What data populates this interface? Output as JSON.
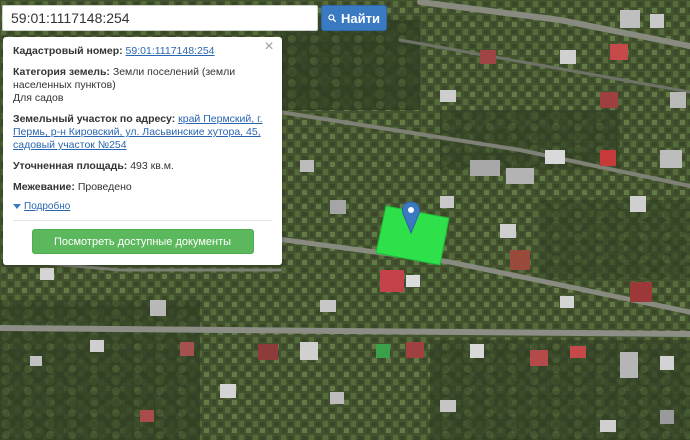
{
  "search": {
    "value": "59:01:1117148:254",
    "button_label": "Найти"
  },
  "info": {
    "cadastral_label": "Кадастровый номер:",
    "cadastral_value": "59:01:1117148:254",
    "category_label": "Категория земель:",
    "category_value_line1": "Земли поселений (земли",
    "category_value_line2": "населенных пунктов)",
    "category_value_line3": "Для садов",
    "address_label": "Земельный участок по адресу:",
    "address_line1": "край Пермский, г.",
    "address_line2": "Пермь, р-н Кировский, ул. Ласьвинские хутора, 45,",
    "address_line3": "садовый участок №254",
    "area_label": "Уточненная площадь:",
    "area_value": "493 кв.м.",
    "survey_label": "Межевание:",
    "survey_value": "Проведено",
    "details_label": "Подробно",
    "docs_button_label": "Посмотреть доступные документы",
    "close_symbol": "×"
  },
  "colors": {
    "parcel_fill": "#2ee04a",
    "pin": "#3a7ac2",
    "search_button": "#3a7ac2",
    "docs_button": "#5cb85c"
  },
  "icons": {
    "search": "search-icon",
    "close": "close-icon",
    "details": "caret-down-icon",
    "marker": "map-pin-icon"
  }
}
